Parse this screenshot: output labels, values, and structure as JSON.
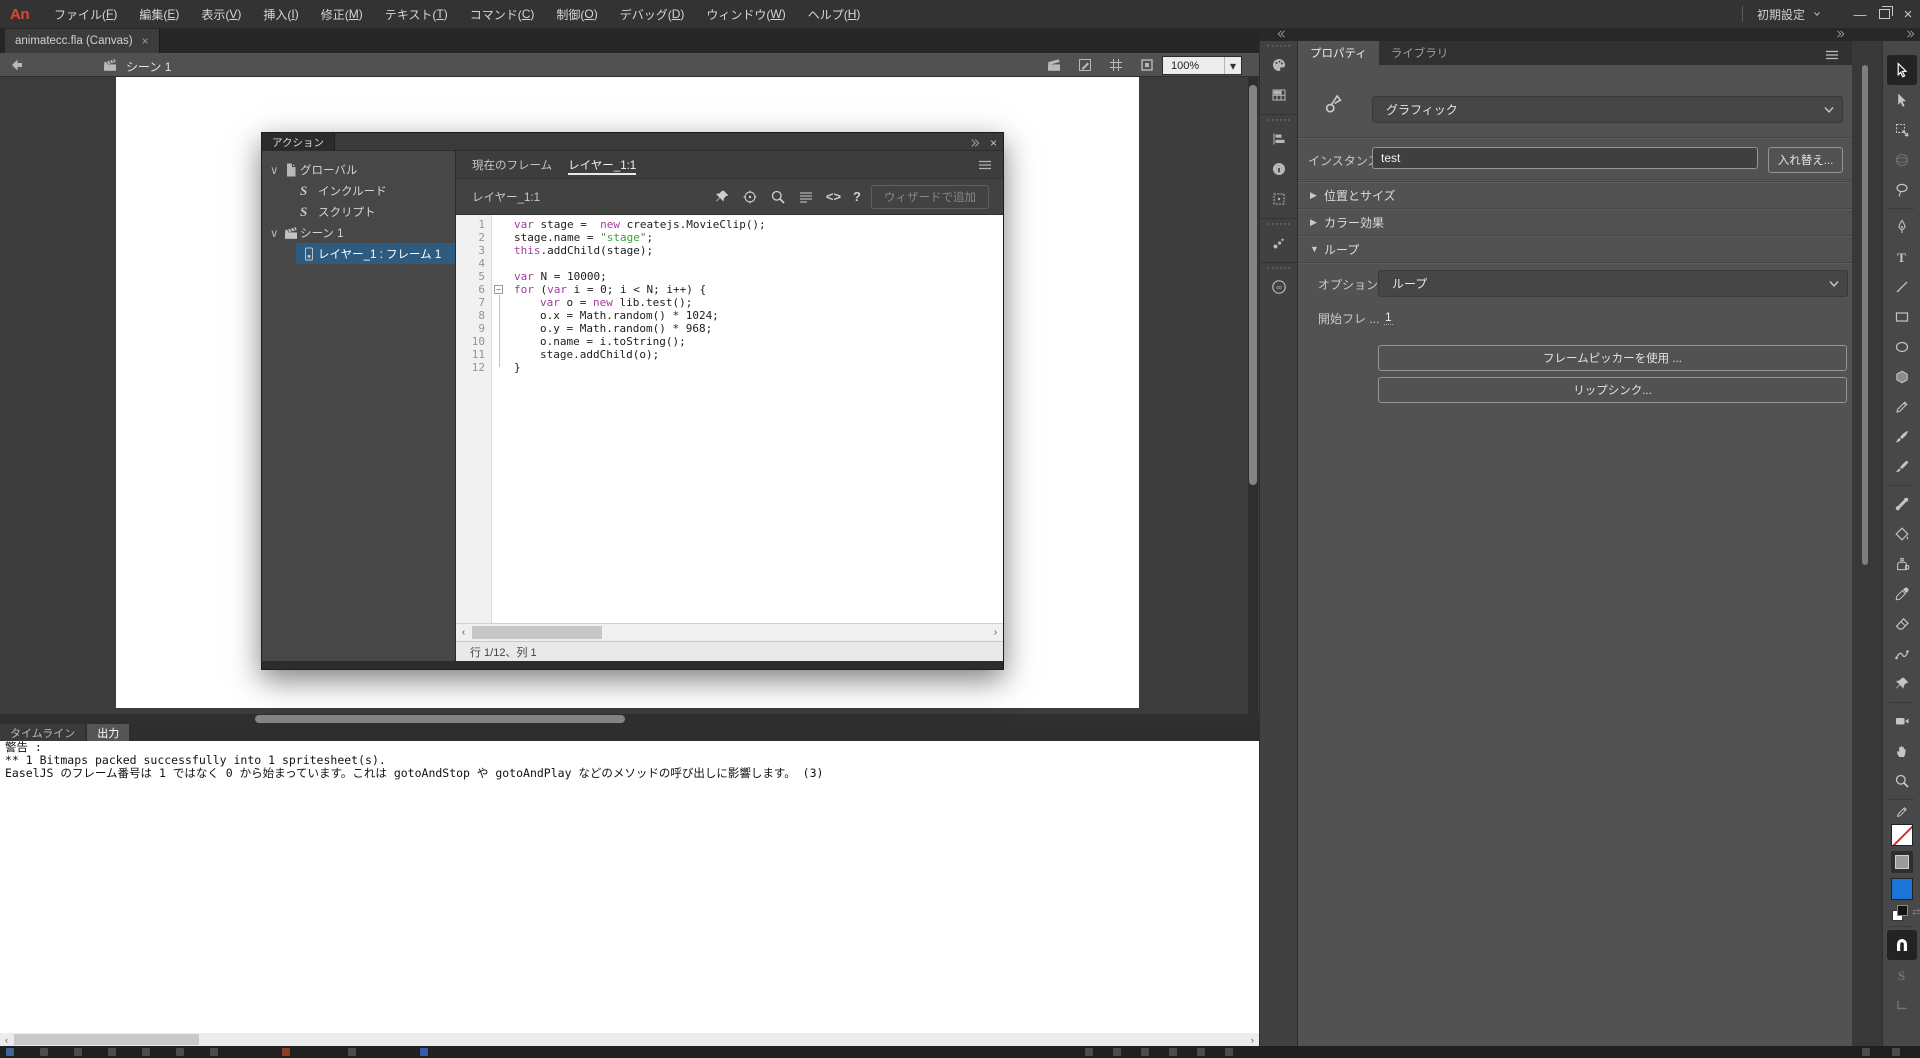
{
  "menubar": {
    "logo": "An",
    "items": [
      {
        "pre": "ファイル",
        "key": "F"
      },
      {
        "pre": "編集",
        "key": "E"
      },
      {
        "pre": "表示",
        "key": "V"
      },
      {
        "pre": "挿入",
        "key": "I"
      },
      {
        "pre": "修正",
        "key": "M"
      },
      {
        "pre": "テキスト",
        "key": "T"
      },
      {
        "pre": "コマンド",
        "key": "C"
      },
      {
        "pre": "制御",
        "key": "O"
      },
      {
        "pre": "デバッグ",
        "key": "D"
      },
      {
        "pre": "ウィンドウ",
        "key": "W"
      },
      {
        "pre": "ヘルプ",
        "key": "H"
      }
    ],
    "workspace": "初期設定",
    "close_label": "×",
    "minimize_label": "—"
  },
  "doc_tab": {
    "label": "animatecc.fla (Canvas)",
    "close": "×"
  },
  "edit_bar": {
    "scene": "シーン 1",
    "zoom_value": "100%"
  },
  "actions": {
    "panel_title": "アクション",
    "tree": [
      {
        "depth": 0,
        "icon": "document",
        "label": "グローバル",
        "expanded": true
      },
      {
        "depth": 1,
        "icon": "script-include",
        "label": "インクルード"
      },
      {
        "depth": 1,
        "icon": "script",
        "label": "スクリプト"
      },
      {
        "depth": 0,
        "icon": "scene",
        "label": "シーン 1",
        "expanded": true
      },
      {
        "depth": 1,
        "icon": "frame",
        "label": "レイヤー_1 : フレーム 1",
        "selected": true
      }
    ],
    "tabs": [
      {
        "label": "現在のフレーム",
        "active": false
      },
      {
        "label": "レイヤー_1:1",
        "active": true
      }
    ],
    "layer_label": "レイヤー_1:1",
    "toolbar_icons": [
      "pin",
      "target",
      "search",
      "format-lines",
      "code",
      "help"
    ],
    "wizard_button": "ウィザードで追加",
    "status": "行 1/12、列 1",
    "code": {
      "fold_start": 6,
      "fold_end": 12,
      "lines": [
        {
          "n": 1,
          "indent": 1,
          "segs": [
            [
              "k",
              "var"
            ],
            [
              "p",
              " stage =  "
            ],
            [
              "k",
              "new"
            ],
            [
              "p",
              " createjs.MovieClip();"
            ]
          ]
        },
        {
          "n": 2,
          "indent": 1,
          "segs": [
            [
              "p",
              "stage.name = "
            ],
            [
              "s",
              "\"stage\""
            ],
            [
              "p",
              ";"
            ]
          ]
        },
        {
          "n": 3,
          "indent": 1,
          "segs": [
            [
              "k",
              "this"
            ],
            [
              "p",
              ".addChild(stage);"
            ]
          ]
        },
        {
          "n": 4,
          "indent": 1,
          "segs": []
        },
        {
          "n": 5,
          "indent": 1,
          "segs": [
            [
              "k",
              "var"
            ],
            [
              "p",
              " N = 10000;"
            ]
          ]
        },
        {
          "n": 6,
          "indent": 1,
          "segs": [
            [
              "k",
              "for"
            ],
            [
              "p",
              " ("
            ],
            [
              "k",
              "var"
            ],
            [
              "p",
              " i = 0; i < N; i++) {"
            ]
          ]
        },
        {
          "n": 7,
          "indent": 2,
          "segs": [
            [
              "k",
              "var"
            ],
            [
              "p",
              " o = "
            ],
            [
              "k",
              "new"
            ],
            [
              "p",
              " lib.test();"
            ]
          ]
        },
        {
          "n": 8,
          "indent": 2,
          "segs": [
            [
              "p",
              "o.x = Math.random() * 1024;"
            ]
          ]
        },
        {
          "n": 9,
          "indent": 2,
          "segs": [
            [
              "p",
              "o.y = Math.random() * 968;"
            ]
          ]
        },
        {
          "n": 10,
          "indent": 2,
          "segs": [
            [
              "p",
              "o.name = i.toString();"
            ]
          ]
        },
        {
          "n": 11,
          "indent": 2,
          "segs": [
            [
              "p",
              "stage.addChild(o);"
            ]
          ]
        },
        {
          "n": 12,
          "indent": 1,
          "segs": [
            [
              "p",
              "}"
            ]
          ]
        }
      ]
    }
  },
  "output": {
    "tabs": [
      "タイムライン",
      "出力"
    ],
    "active_tab": "出力",
    "lines": [
      "警告 :",
      "** 1 Bitmaps packed successfully into 1 spritesheet(s).",
      "EaselJS のフレーム番号は 1 ではなく 0 から始まっています。これは gotoAndStop や gotoAndPlay などのメソッドの呼び出しに影響します。 (3)"
    ]
  },
  "properties": {
    "tabs": [
      "プロパティ",
      "ライブラリ"
    ],
    "active_tab": "プロパティ",
    "symbol_type": "グラフィック",
    "instance_label": "インスタンス :",
    "instance_value": "test",
    "swap_button": "入れ替え...",
    "sections": [
      {
        "label": "位置とサイズ",
        "expanded": false
      },
      {
        "label": "カラー効果",
        "expanded": false
      },
      {
        "label": "ループ",
        "expanded": true
      }
    ],
    "option_label": "オプション :",
    "option_value": "ループ",
    "start_frame_label": "開始フレ ...",
    "start_frame_value": "1",
    "frame_picker_button": "フレームピッカーを使用 ...",
    "lip_sync_button": "リップシンク..."
  },
  "tools": {
    "fill_color": "#1b74d6",
    "stroke_color": "none",
    "items": [
      {
        "icon": "selection",
        "state": "active"
      },
      {
        "icon": "subselection"
      },
      {
        "icon": "free-transform"
      },
      {
        "icon": "rotation-3d",
        "state": "disabled"
      },
      {
        "icon": "lasso"
      },
      {
        "sep": true
      },
      {
        "icon": "pen"
      },
      {
        "icon": "text"
      },
      {
        "icon": "line"
      },
      {
        "icon": "rectangle"
      },
      {
        "icon": "oval"
      },
      {
        "icon": "polystar"
      },
      {
        "icon": "pencil"
      },
      {
        "icon": "paint-brush"
      },
      {
        "icon": "classic-brush"
      },
      {
        "sep": true
      },
      {
        "icon": "bone"
      },
      {
        "icon": "paint-bucket"
      },
      {
        "icon": "ink-bottle"
      },
      {
        "icon": "eyedropper"
      },
      {
        "icon": "eraser"
      },
      {
        "icon": "width"
      },
      {
        "icon": "pin"
      },
      {
        "sep": true
      },
      {
        "icon": "camera"
      },
      {
        "icon": "hand"
      },
      {
        "icon": "zoom"
      },
      {
        "sep": true
      },
      {
        "swatches": true
      },
      {
        "sep": true
      },
      {
        "icon": "magnet",
        "state": "active"
      },
      {
        "icon": "smooth",
        "state": "disabled"
      },
      {
        "icon": "straighten",
        "state": "disabled"
      }
    ]
  },
  "dock": {
    "groups": [
      [
        "color",
        "swatches"
      ],
      [
        "align",
        "info",
        "transform"
      ],
      [
        "motion-presets"
      ],
      [
        "creative-cloud"
      ]
    ]
  }
}
